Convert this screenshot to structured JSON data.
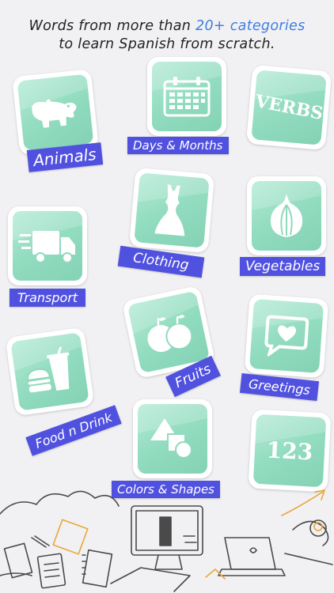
{
  "headline": {
    "line1_prefix": "Words from more than ",
    "line1_accent": "20+ categories",
    "line2": "to learn Spanish from scratch."
  },
  "categories": {
    "animals": {
      "label": "Animals",
      "icon": "hippo-icon"
    },
    "days_months": {
      "label": "Days & Months",
      "icon": "calendar-icon"
    },
    "verbs": {
      "label": "VERBS",
      "icon": "verbs-text-icon"
    },
    "clothing": {
      "label": "Clothing",
      "icon": "dress-icon"
    },
    "vegetables": {
      "label": "Vegetables",
      "icon": "onion-icon"
    },
    "transport": {
      "label": "Transport",
      "icon": "truck-icon"
    },
    "fruits": {
      "label": "Fruits",
      "icon": "apples-icon"
    },
    "greetings": {
      "label": "Greetings",
      "icon": "speech-heart-icon"
    },
    "food_drink": {
      "label": "Food n Drink",
      "icon": "burger-drink-icon"
    },
    "colors_shapes": {
      "label": "Colors & Shapes",
      "icon": "shapes-icon"
    },
    "numbers": {
      "label": "123",
      "icon": "numbers-icon"
    }
  },
  "colors": {
    "accent_text": "#3f7ee0",
    "label_bg": "#5151e0",
    "tile_green": "#92dcc0",
    "background": "#f1f1f3"
  }
}
